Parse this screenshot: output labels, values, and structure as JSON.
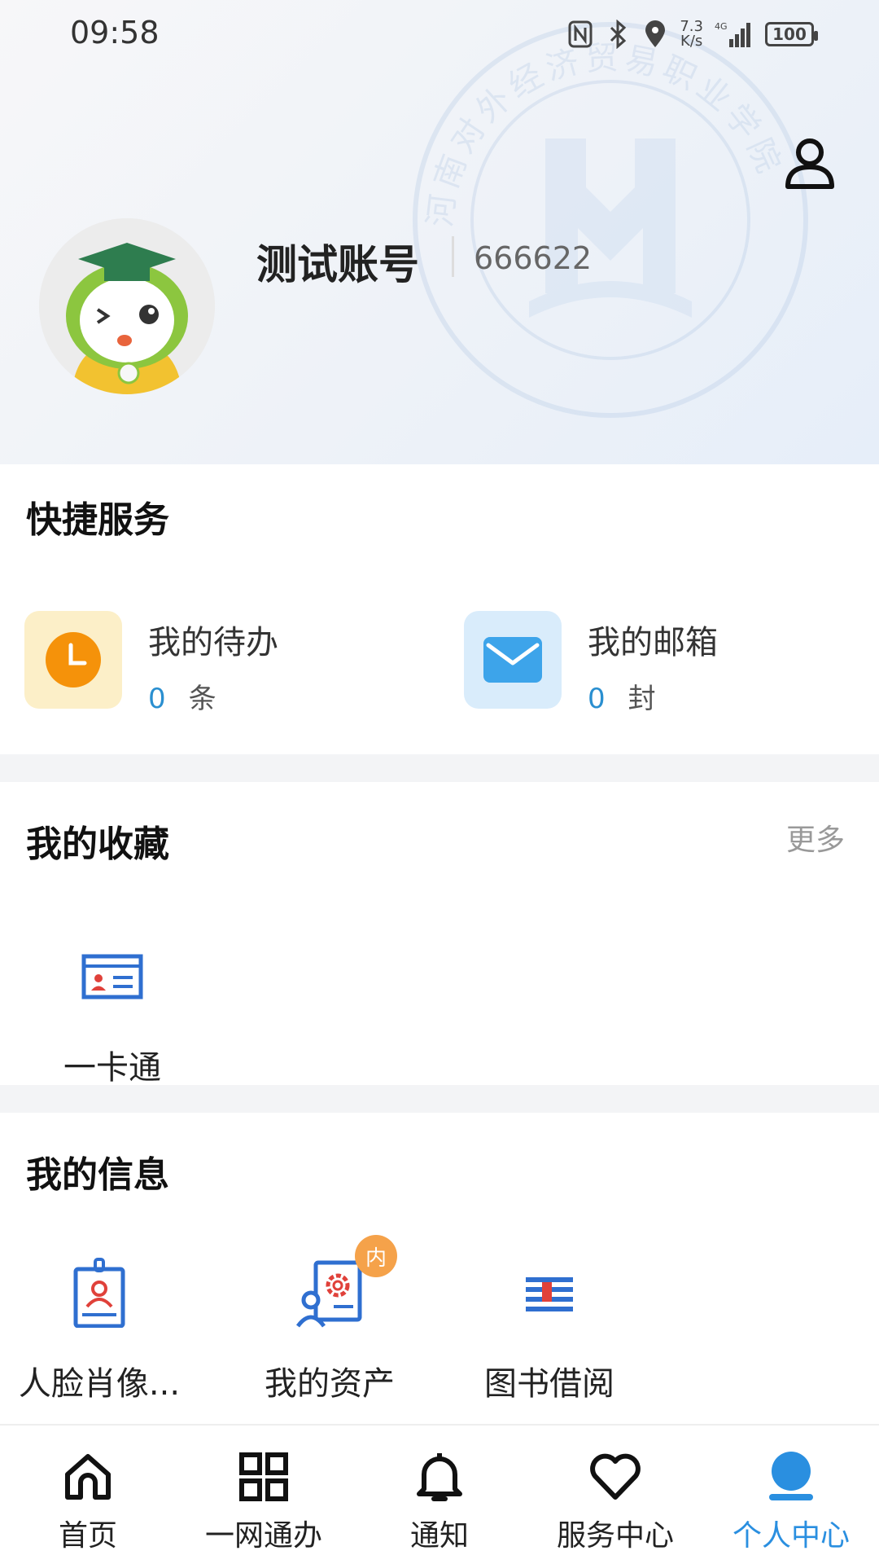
{
  "status_bar": {
    "time": "09:58",
    "net_speed_top": "7.3",
    "net_speed_bottom": "K/s",
    "network": "4G",
    "battery": "100",
    "icons": [
      "nfc-icon",
      "bluetooth-icon",
      "location-icon",
      "signal-icon",
      "battery-icon"
    ]
  },
  "header": {
    "watermark_text": "河南对外经济贸易职业学院",
    "profile_icon": "person-icon"
  },
  "user": {
    "name": "测试账号",
    "id": "666622",
    "avatar": "mascot-avatar"
  },
  "quick_services": {
    "title": "快捷服务",
    "items": [
      {
        "label": "我的待办",
        "count": "0",
        "unit": "条",
        "icon": "clock-icon",
        "icon_bg": "#fcefc8",
        "icon_color": "#f5920a"
      },
      {
        "label": "我的邮箱",
        "count": "0",
        "unit": "封",
        "icon": "mail-icon",
        "icon_bg": "#d9ecfb",
        "icon_color": "#3da4ea"
      }
    ]
  },
  "favorites": {
    "title": "我的收藏",
    "more": "更多",
    "items": [
      {
        "label": "一卡通",
        "icon": "id-card-icon"
      }
    ]
  },
  "my_info": {
    "title": "我的信息",
    "items": [
      {
        "label": "人脸肖像...",
        "icon": "badge-portrait-icon"
      },
      {
        "label": "我的资产",
        "icon": "asset-gear-icon",
        "badge": "内"
      },
      {
        "label": "图书借阅",
        "icon": "books-icon"
      }
    ]
  },
  "bottom_nav": {
    "items": [
      {
        "label": "首页",
        "icon": "home-icon",
        "active": false
      },
      {
        "label": "一网通办",
        "icon": "grid-icon",
        "active": false
      },
      {
        "label": "通知",
        "icon": "bell-icon",
        "active": false
      },
      {
        "label": "服务中心",
        "icon": "heart-icon",
        "active": false
      },
      {
        "label": "个人中心",
        "icon": "user-icon",
        "active": true
      }
    ],
    "active_color": "#2a8fe0"
  }
}
